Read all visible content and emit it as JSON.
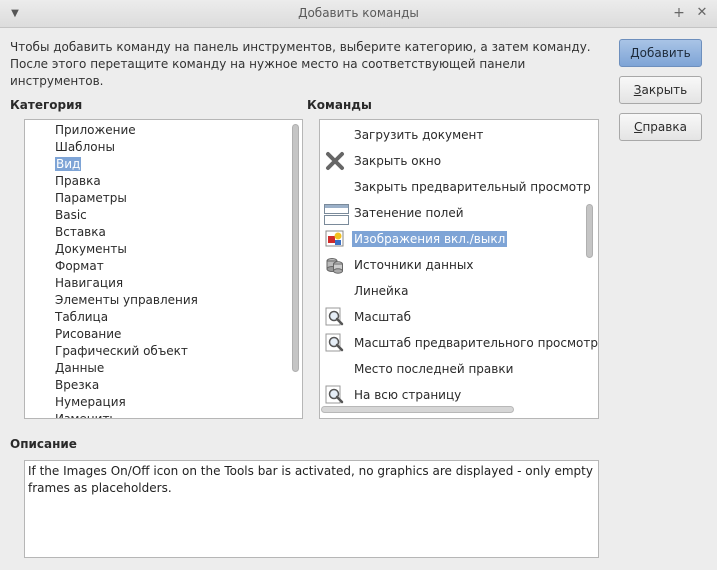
{
  "window": {
    "title": "Добавить команды"
  },
  "instructions": "Чтобы добавить команду на панель инструментов, выберите категорию, а затем команду. После этого перетащите команду на нужное место на соответствующей панели инструментов.",
  "buttons": {
    "add": "Добавить",
    "close_first": "З",
    "close_rest": "акрыть",
    "help_first": "С",
    "help_rest": "правка"
  },
  "category": {
    "heading": "Категория",
    "items": [
      "Приложение",
      "Шаблоны",
      "Вид",
      "Правка",
      "Параметры",
      "Basic",
      "Вставка",
      "Документы",
      "Формат",
      "Навигация",
      "Элементы управления",
      "Таблица",
      "Рисование",
      "Графический объект",
      "Данные",
      "Врезка",
      "Нумерация",
      "Изменить"
    ],
    "selected": "Вид"
  },
  "commands": {
    "heading": "Команды",
    "items": [
      {
        "label": "Загрузить документ",
        "icon": "none"
      },
      {
        "label": "Закрыть окно",
        "icon": "close-x-icon"
      },
      {
        "label": "Закрыть предварительный просмотр",
        "icon": "none"
      },
      {
        "label": "Затенение полей",
        "icon": "field-shading-icon"
      },
      {
        "label": "Изображения вкл./выкл",
        "icon": "images-toggle-icon"
      },
      {
        "label": "Источники данных",
        "icon": "data-sources-icon"
      },
      {
        "label": "Линейка",
        "icon": "none"
      },
      {
        "label": "Масштаб",
        "icon": "zoom-icon"
      },
      {
        "label": "Масштаб предварительного просмотра",
        "icon": "zoom-icon"
      },
      {
        "label": "Место последней правки",
        "icon": "none"
      },
      {
        "label": "На всю страницу",
        "icon": "zoom-icon"
      }
    ],
    "selected": "Изображения вкл./выкл"
  },
  "description": {
    "heading": "Описание",
    "text": "If the Images On/Off icon on the Tools bar is activated, no graphics are displayed - only empty frames as placeholders."
  },
  "colors": {
    "selection": "#7ea4d6",
    "primary_button": "#8fb0dc"
  }
}
